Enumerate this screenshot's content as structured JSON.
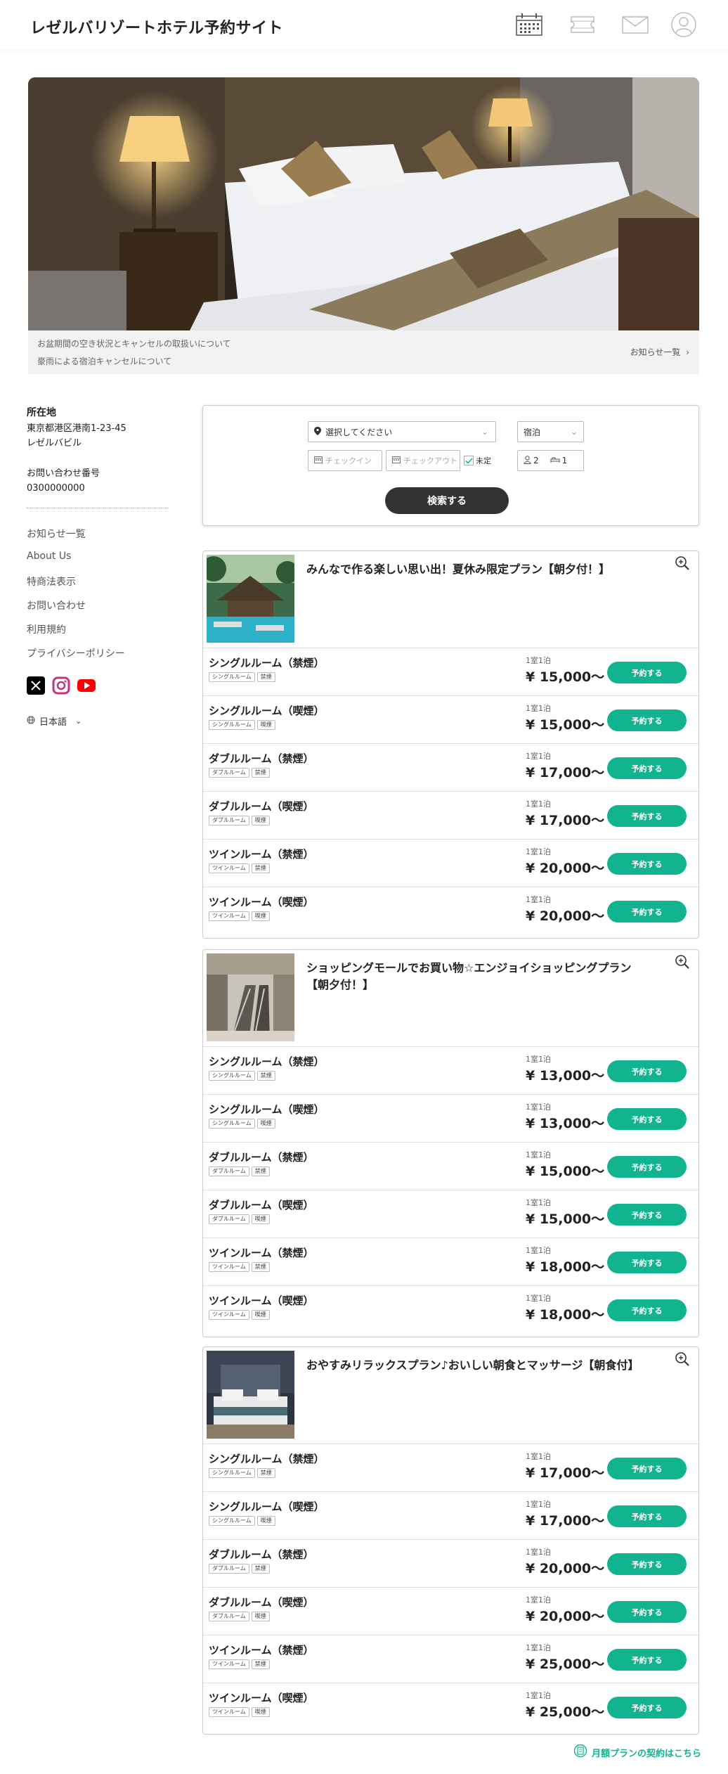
{
  "header": {
    "site_title": "レゼルバリゾートホテル予約サイト",
    "icons": [
      "calendar-icon",
      "ticket-icon",
      "mail-icon",
      "user-icon"
    ]
  },
  "notices": {
    "items": [
      "お盆期間の空き状況とキャンセルの取扱いについて",
      "豪雨による宿泊キャンセルについて"
    ],
    "all_link": "お知らせ一覧"
  },
  "sidebar": {
    "location_heading": "所在地",
    "address_line1": "東京都港区港南1-23-45",
    "address_line2": "レゼルバビル",
    "contact_heading": "お問い合わせ番号",
    "phone": "0300000000",
    "nav": [
      "お知らせ一覧",
      "About Us",
      "特商法表示",
      "お問い合わせ",
      "利用規約",
      "プライバシーポリシー"
    ],
    "language": "日本語",
    "colors": {
      "instagram": "#c13584",
      "youtube": "#ff0000"
    }
  },
  "search": {
    "area_placeholder": "選択してください",
    "type_value": "宿泊",
    "checkin_placeholder": "チェックイン",
    "checkout_placeholder": "チェックアウト",
    "undecided_label": "未定",
    "adults": "2",
    "rooms": "1",
    "submit_label": "検索する"
  },
  "room_labels": {
    "per_night": "1室1泊",
    "book_label": "予約する"
  },
  "plans": [
    {
      "title": "みんなで作る楽しい思い出！夏休み限定プラン【朝夕付！】",
      "rooms": [
        {
          "name": "シングルルーム（禁煙）",
          "tags": [
            "シングルルーム",
            "禁煙"
          ],
          "price": "¥ 15,000〜"
        },
        {
          "name": "シングルルーム（喫煙）",
          "tags": [
            "シングルルーム",
            "喫煙"
          ],
          "price": "¥ 15,000〜"
        },
        {
          "name": "ダブルルーム（禁煙）",
          "tags": [
            "ダブルルーム",
            "禁煙"
          ],
          "price": "¥ 17,000〜"
        },
        {
          "name": "ダブルルーム（喫煙）",
          "tags": [
            "ダブルルーム",
            "喫煙"
          ],
          "price": "¥ 17,000〜"
        },
        {
          "name": "ツインルーム（禁煙）",
          "tags": [
            "ツインルーム",
            "禁煙"
          ],
          "price": "¥ 20,000〜"
        },
        {
          "name": "ツインルーム（喫煙）",
          "tags": [
            "ツインルーム",
            "喫煙"
          ],
          "price": "¥ 20,000〜"
        }
      ]
    },
    {
      "title": "ショッピングモールでお買い物☆エンジョイショッピングプラン【朝夕付！】",
      "rooms": [
        {
          "name": "シングルルーム（禁煙）",
          "tags": [
            "シングルルーム",
            "禁煙"
          ],
          "price": "¥ 13,000〜"
        },
        {
          "name": "シングルルーム（喫煙）",
          "tags": [
            "シングルルーム",
            "喫煙"
          ],
          "price": "¥ 13,000〜"
        },
        {
          "name": "ダブルルーム（禁煙）",
          "tags": [
            "ダブルルーム",
            "禁煙"
          ],
          "price": "¥ 15,000〜"
        },
        {
          "name": "ダブルルーム（喫煙）",
          "tags": [
            "ダブルルーム",
            "喫煙"
          ],
          "price": "¥ 15,000〜"
        },
        {
          "name": "ツインルーム（禁煙）",
          "tags": [
            "ツインルーム",
            "禁煙"
          ],
          "price": "¥ 18,000〜"
        },
        {
          "name": "ツインルーム（喫煙）",
          "tags": [
            "ツインルーム",
            "喫煙"
          ],
          "price": "¥ 18,000〜"
        }
      ]
    },
    {
      "title": "おやすみリラックスプラン♪おいしい朝食とマッサージ【朝食付】",
      "rooms": [
        {
          "name": "シングルルーム（禁煙）",
          "tags": [
            "シングルルーム",
            "禁煙"
          ],
          "price": "¥ 17,000〜"
        },
        {
          "name": "シングルルーム（喫煙）",
          "tags": [
            "シングルルーム",
            "喫煙"
          ],
          "price": "¥ 17,000〜"
        },
        {
          "name": "ダブルルーム（禁煙）",
          "tags": [
            "ダブルルーム",
            "禁煙"
          ],
          "price": "¥ 20,000〜"
        },
        {
          "name": "ダブルルーム（喫煙）",
          "tags": [
            "ダブルルーム",
            "喫煙"
          ],
          "price": "¥ 20,000〜"
        },
        {
          "name": "ツインルーム（禁煙）",
          "tags": [
            "ツインルーム",
            "禁煙"
          ],
          "price": "¥ 25,000〜"
        },
        {
          "name": "ツインルーム（喫煙）",
          "tags": [
            "ツインルーム",
            "喫煙"
          ],
          "price": "¥ 25,000〜"
        }
      ]
    }
  ],
  "footer": {
    "monthly_link": "月額プランの契約はこちら"
  },
  "colors": {
    "accent": "#12b48f",
    "dark_button": "#333333"
  }
}
